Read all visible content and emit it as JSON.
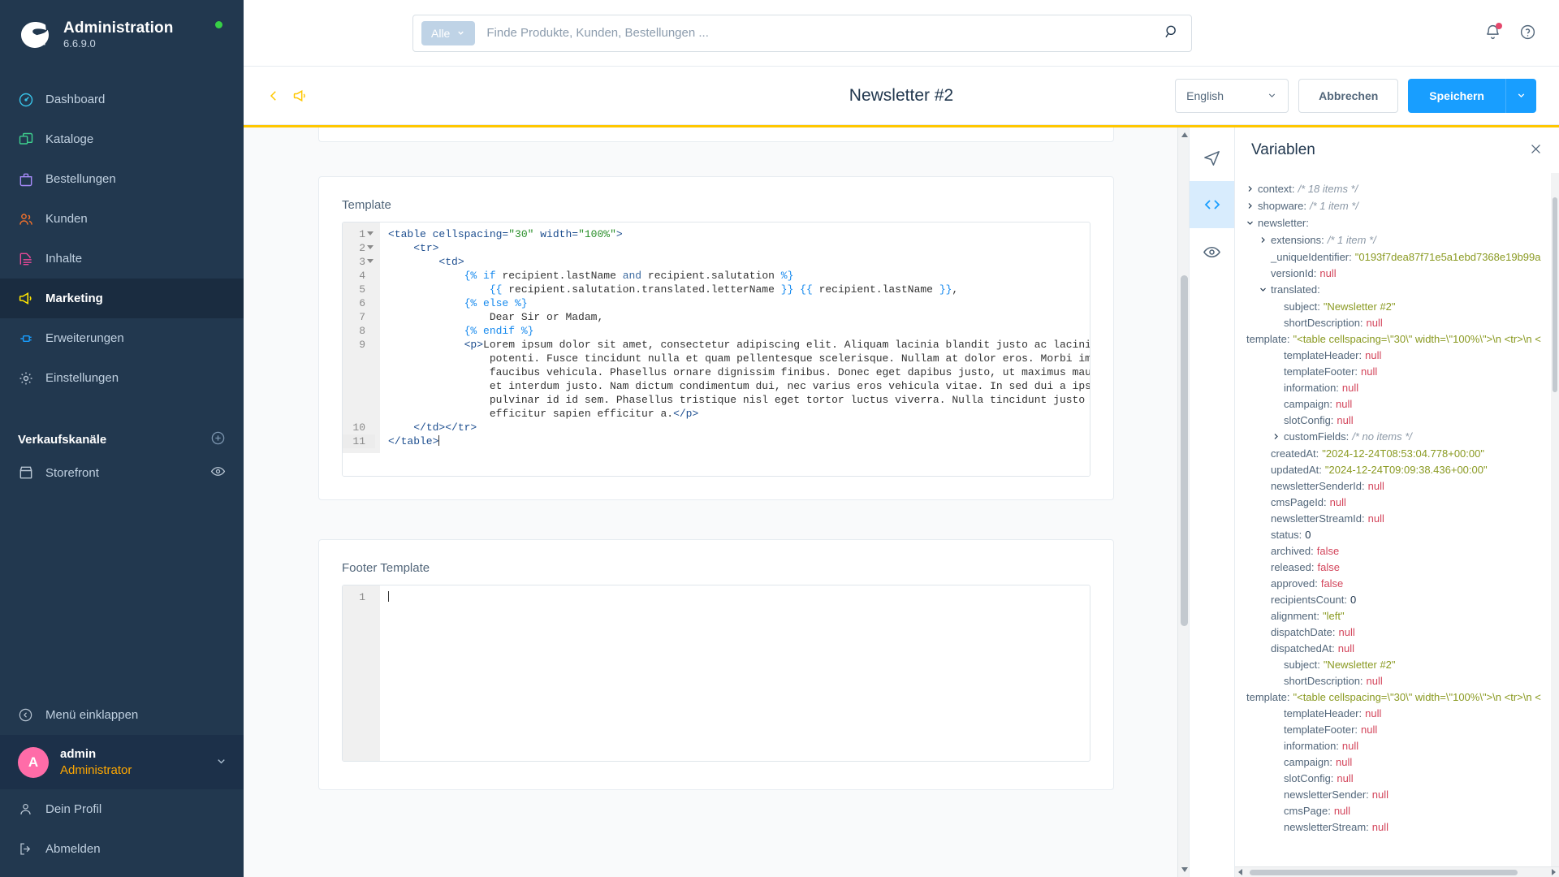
{
  "sidebar": {
    "brand": {
      "title": "Administration",
      "version": "6.6.9.0"
    },
    "items": [
      {
        "label": "Dashboard",
        "icon": "dashboard-icon"
      },
      {
        "label": "Kataloge",
        "icon": "catalog-icon"
      },
      {
        "label": "Bestellungen",
        "icon": "orders-icon"
      },
      {
        "label": "Kunden",
        "icon": "customers-icon"
      },
      {
        "label": "Inhalte",
        "icon": "content-icon"
      },
      {
        "label": "Marketing",
        "icon": "marketing-icon"
      },
      {
        "label": "Erweiterungen",
        "icon": "extensions-icon"
      },
      {
        "label": "Einstellungen",
        "icon": "settings-icon"
      }
    ],
    "active_item": "Marketing",
    "sales_channel_header": "Verkaufskanäle",
    "sales_channels": [
      {
        "label": "Storefront",
        "icon": "eye-icon"
      }
    ],
    "collapse_label": "Menü einklappen",
    "user": {
      "avatar_initial": "A",
      "name": "admin",
      "role": "Administrator"
    },
    "user_menu": [
      {
        "label": "Dein Profil",
        "icon": "user-icon"
      },
      {
        "label": "Abmelden",
        "icon": "logout-icon"
      }
    ]
  },
  "topbar": {
    "scope_label": "Alle",
    "search_placeholder": "Finde Produkte, Kunden, Bestellungen ...",
    "search_value": "",
    "notifications_icon": "bell-icon",
    "help_icon": "help-icon"
  },
  "smartbar": {
    "back_icon": "chevron-left-icon",
    "module_icon": "marketing-icon",
    "page_title": "Newsletter #2",
    "language": "English",
    "cancel_label": "Abbrechen",
    "save_label": "Speichern"
  },
  "editor_cards": [
    {
      "label": "Template"
    },
    {
      "label": "Footer Template"
    }
  ],
  "template_editor": {
    "label": "Template",
    "lines": [
      {
        "n": "1",
        "fold": true,
        "text": "<table cellspacing=\"30\" width=\"100%\">"
      },
      {
        "n": "2",
        "fold": true,
        "text": "    <tr>"
      },
      {
        "n": "3",
        "fold": true,
        "text": "        <td>"
      },
      {
        "n": "4",
        "fold": false,
        "text": "            {% if recipient.lastName and recipient.salutation %}"
      },
      {
        "n": "5",
        "fold": false,
        "text": "                {{ recipient.salutation.translated.letterName }} {{ recipient.lastName }},"
      },
      {
        "n": "6",
        "fold": false,
        "text": "            {% else %}"
      },
      {
        "n": "7",
        "fold": false,
        "text": "                Dear Sir or Madam,"
      },
      {
        "n": "8",
        "fold": false,
        "text": "            {% endif %}"
      },
      {
        "n": "9",
        "fold": false,
        "text": "            <p>Lorem ipsum dolor sit amet, consectetur adipiscing elit. Aliquam lacinia blandit justo ac lacinia. Suspendisse"
      },
      {
        "n": "",
        "fold": false,
        "text": "                potenti. Fusce tincidunt nulla et quam pellentesque scelerisque. Nullam at dolor eros. Morbi imperdiet nibh ac"
      },
      {
        "n": "",
        "fold": false,
        "text": "                faucibus vehicula. Phasellus ornare dignissim finibus. Donec eget dapibus justo, ut maximus mauris. Vestibulum"
      },
      {
        "n": "",
        "fold": false,
        "text": "                et interdum justo. Nam dictum condimentum dui, nec varius eros vehicula vitae. In sed dui a ipsum efficitur"
      },
      {
        "n": "",
        "fold": false,
        "text": "                pulvinar id id sem. Phasellus tristique nisl eget tortor luctus viverra. Nulla tincidunt justo nunc, vitae"
      },
      {
        "n": "",
        "fold": false,
        "text": "                efficitur sapien efficitur a.</p>"
      },
      {
        "n": "10",
        "fold": false,
        "text": "    </td></tr>"
      },
      {
        "n": "11",
        "fold": false,
        "text": "</table>"
      }
    ]
  },
  "footer_editor": {
    "label": "Footer Template",
    "lines": [
      {
        "n": "1",
        "fold": false,
        "text": ""
      }
    ]
  },
  "rail": [
    {
      "icon": "send-icon",
      "active": false
    },
    {
      "icon": "code-icon",
      "active": true
    },
    {
      "icon": "eye-icon",
      "active": false
    }
  ],
  "variables": {
    "title": "Variablen",
    "close_icon": "close-icon",
    "rows": [
      {
        "indent": 0,
        "arrow": "right",
        "key": "context:",
        "comment": "/* 18 items */"
      },
      {
        "indent": 0,
        "arrow": "right",
        "key": "shopware:",
        "comment": "/* 1 item */"
      },
      {
        "indent": 0,
        "arrow": "down",
        "key": "newsletter:"
      },
      {
        "indent": 1,
        "arrow": "right",
        "key": "extensions:",
        "comment": "/* 1 item */"
      },
      {
        "indent": 1,
        "arrow": "none",
        "key": "_uniqueIdentifier:",
        "str": "\"0193f7dea87f71e5a1ebd7368e19b99a"
      },
      {
        "indent": 1,
        "arrow": "none",
        "key": "versionId:",
        "null": "null"
      },
      {
        "indent": 1,
        "arrow": "down",
        "key": "translated:"
      },
      {
        "indent": 2,
        "arrow": "none",
        "key": "subject:",
        "str": "\"Newsletter #2\""
      },
      {
        "indent": 2,
        "arrow": "none",
        "key": "shortDescription:",
        "null": "null"
      },
      {
        "indent": -1,
        "arrow": "none",
        "key": "template:",
        "str": "\"<table cellspacing=\\\"30\\\" width=\\\"100%\\\">\\n <tr>\\n <"
      },
      {
        "indent": 2,
        "arrow": "none",
        "key": "templateHeader:",
        "null": "null"
      },
      {
        "indent": 2,
        "arrow": "none",
        "key": "templateFooter:",
        "null": "null"
      },
      {
        "indent": 2,
        "arrow": "none",
        "key": "information:",
        "null": "null"
      },
      {
        "indent": 2,
        "arrow": "none",
        "key": "campaign:",
        "null": "null"
      },
      {
        "indent": 2,
        "arrow": "none",
        "key": "slotConfig:",
        "null": "null"
      },
      {
        "indent": 2,
        "arrow": "right",
        "key": "customFields:",
        "comment": "/* no items */"
      },
      {
        "indent": 1,
        "arrow": "none",
        "key": "createdAt:",
        "str": "\"2024-12-24T08:53:04.778+00:00\""
      },
      {
        "indent": 1,
        "arrow": "none",
        "key": "updatedAt:",
        "str": "\"2024-12-24T09:09:38.436+00:00\""
      },
      {
        "indent": 1,
        "arrow": "none",
        "key": "newsletterSenderId:",
        "null": "null"
      },
      {
        "indent": 1,
        "arrow": "none",
        "key": "cmsPageId:",
        "null": "null"
      },
      {
        "indent": 1,
        "arrow": "none",
        "key": "newsletterStreamId:",
        "null": "null"
      },
      {
        "indent": 1,
        "arrow": "none",
        "key": "status:",
        "num": "0"
      },
      {
        "indent": 1,
        "arrow": "none",
        "key": "archived:",
        "bool": "false"
      },
      {
        "indent": 1,
        "arrow": "none",
        "key": "released:",
        "bool": "false"
      },
      {
        "indent": 1,
        "arrow": "none",
        "key": "approved:",
        "bool": "false"
      },
      {
        "indent": 1,
        "arrow": "none",
        "key": "recipientsCount:",
        "num": "0"
      },
      {
        "indent": 1,
        "arrow": "none",
        "key": "alignment:",
        "str": "\"left\""
      },
      {
        "indent": 1,
        "arrow": "none",
        "key": "dispatchDate:",
        "null": "null"
      },
      {
        "indent": 1,
        "arrow": "none",
        "key": "dispatchedAt:",
        "null": "null"
      },
      {
        "indent": 2,
        "arrow": "none",
        "key": "subject:",
        "str": "\"Newsletter #2\""
      },
      {
        "indent": 2,
        "arrow": "none",
        "key": "shortDescription:",
        "null": "null"
      },
      {
        "indent": -1,
        "arrow": "none",
        "key": "template:",
        "str": "\"<table cellspacing=\\\"30\\\" width=\\\"100%\\\">\\n <tr>\\n <"
      },
      {
        "indent": 2,
        "arrow": "none",
        "key": "templateHeader:",
        "null": "null"
      },
      {
        "indent": 2,
        "arrow": "none",
        "key": "templateFooter:",
        "null": "null"
      },
      {
        "indent": 2,
        "arrow": "none",
        "key": "information:",
        "null": "null"
      },
      {
        "indent": 2,
        "arrow": "none",
        "key": "campaign:",
        "null": "null"
      },
      {
        "indent": 2,
        "arrow": "none",
        "key": "slotConfig:",
        "null": "null"
      },
      {
        "indent": 2,
        "arrow": "none",
        "key": "newsletterSender:",
        "null": "null"
      },
      {
        "indent": 2,
        "arrow": "none",
        "key": "cmsPage:",
        "null": "null"
      },
      {
        "indent": 2,
        "arrow": "none",
        "key": "newsletterStream:",
        "null": "null"
      }
    ]
  },
  "colors": {
    "sidebar_bg": "#22384f",
    "accent_blue": "#189eff",
    "accent_yellow": "#ffc700",
    "avatar_pink": "#ff6ca8",
    "role_orange": "#ffa800",
    "status_green": "#37d046"
  }
}
